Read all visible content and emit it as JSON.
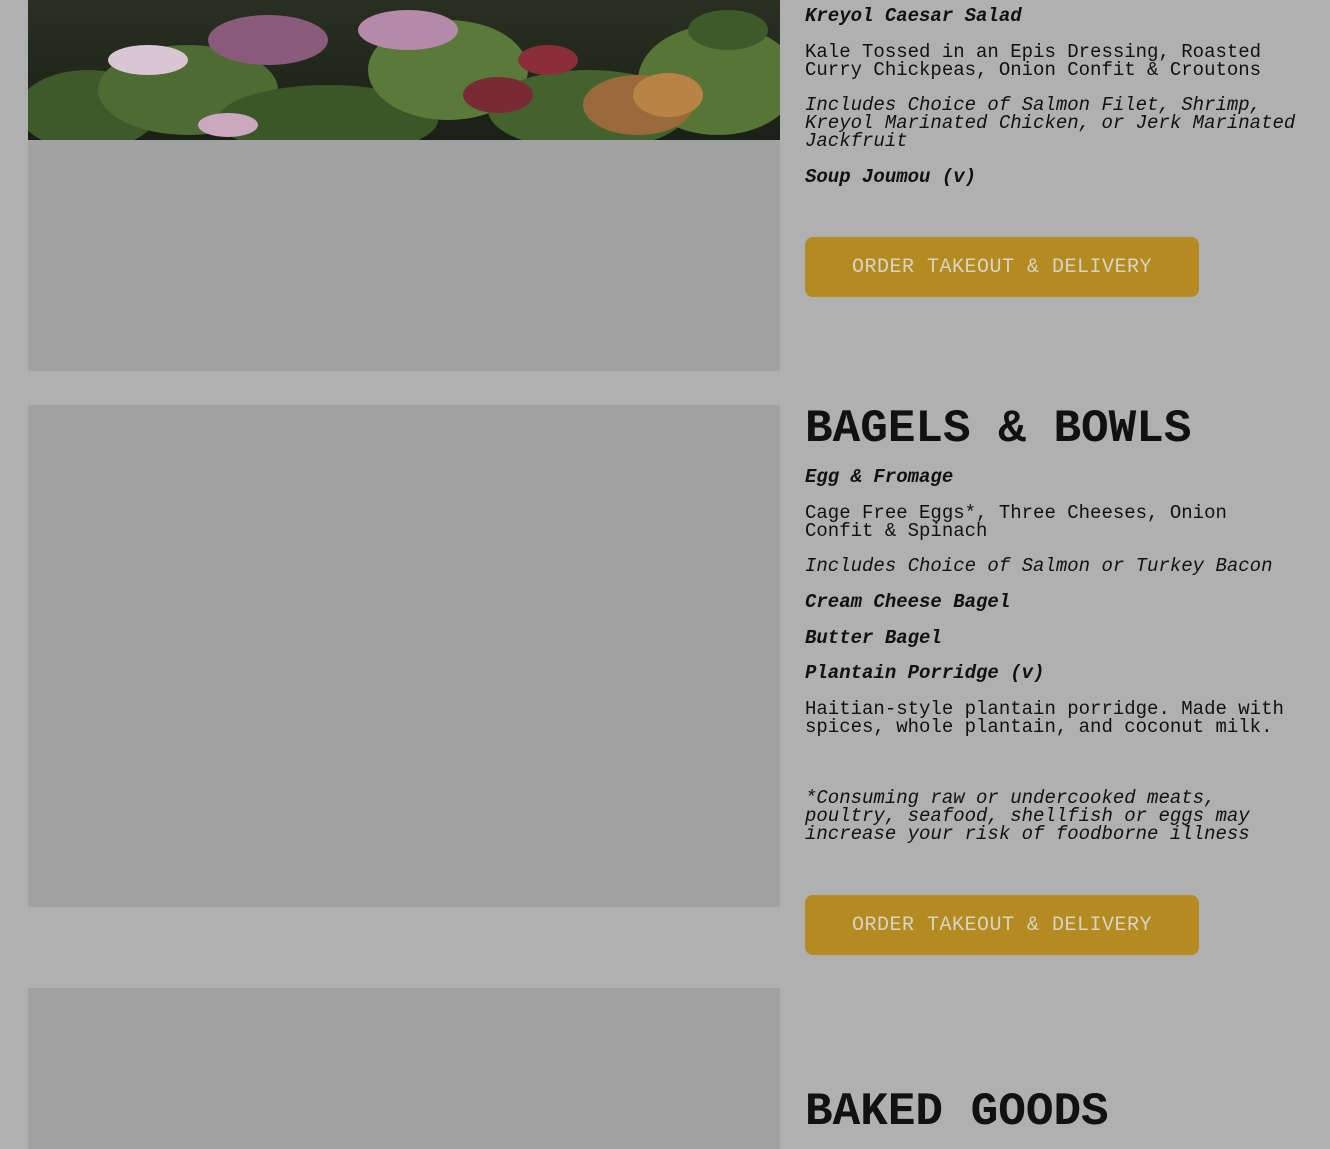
{
  "sections": {
    "salads": {
      "items": [
        {
          "name": "Kreyol Caesar Salad",
          "description": "Kale Tossed in an Epis Dressing, Roasted Curry Chickpeas, Onion Confit & Croutons",
          "note": "Includes Choice of Salmon Filet, Shrimp, Kreyol Marinated Chicken, or Jerk Marinated Jackfruit"
        },
        {
          "name": "Soup Joumou (v)"
        }
      ],
      "order_button": "ORDER TAKEOUT & DELIVERY"
    },
    "bagels": {
      "title": "BAGELS & BOWLS",
      "items": [
        {
          "name": "Egg & Fromage",
          "description": "Cage Free Eggs*, Three Cheeses, Onion Confit & Spinach",
          "note": "Includes Choice of Salmon or Turkey Bacon"
        },
        {
          "name": "Cream Cheese Bagel"
        },
        {
          "name": "Butter Bagel"
        },
        {
          "name": "Plantain Porridge (v)",
          "description": "Haitian-style plantain porridge. Made with spices, whole plantain, and coconut milk."
        }
      ],
      "disclaimer": "*Consuming raw or undercooked meats, poultry, seafood, shellfish or eggs may increase your risk of foodborne illness",
      "order_button": "ORDER TAKEOUT & DELIVERY"
    },
    "baked": {
      "title": "BAKED GOODS"
    }
  },
  "colors": {
    "background": "#b0b0b0",
    "image_placeholder": "#a2a2a2",
    "button": "#b38b21",
    "button_text": "#d9d4c4"
  }
}
